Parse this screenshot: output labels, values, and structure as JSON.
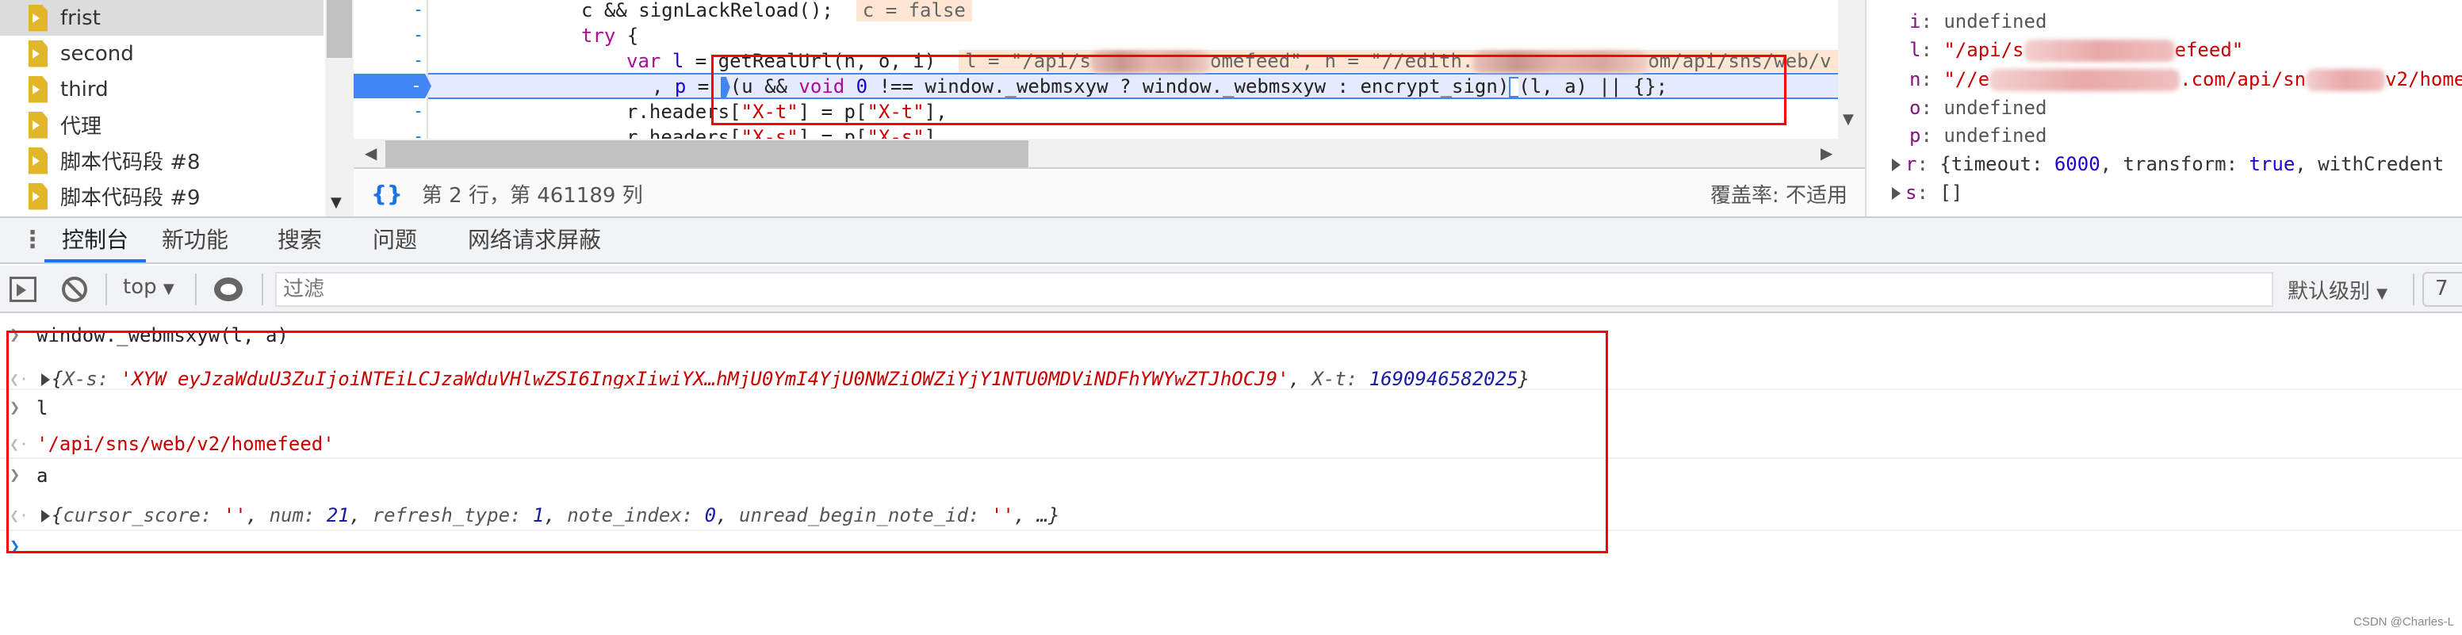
{
  "sidebar": {
    "items": [
      {
        "label": "frist",
        "selected": true,
        "icon": "snippet-file-icon"
      },
      {
        "label": "second",
        "icon": "snippet-file-icon"
      },
      {
        "label": "third",
        "icon": "snippet-file-icon"
      },
      {
        "label": "代理",
        "icon": "snippet-file-icon"
      },
      {
        "label": "脚本代码段 #8",
        "icon": "snippet-file-icon"
      },
      {
        "label": "脚本代码段 #9",
        "icon": "snippet-file-icon"
      }
    ]
  },
  "editor": {
    "gutter_marker": "-",
    "lines": {
      "l0": "c && signLackReload();",
      "l0_inline": "c = false",
      "l1_kw": "try",
      "l1_rest": " {",
      "l2_kw": "var",
      "l2_var": "l",
      "l2_rest": " = getRealUrl(n, o, i)",
      "l2_inline_a": "l = \"/api/s",
      "l2_inline_b": "omefeed\", n = \"//edith.",
      "l2_inline_c": "om/api/sns/web/v",
      "l3_a": ", ",
      "l3_var": "p",
      "l3_b": " = ",
      "l3_c": "(u && ",
      "l3_kw": "void",
      "l3_num": "0",
      "l3_d": " !== window._webmsxyw ? window._webmsxyw : encrypt_sign)",
      "l3_e": "(l, a) || {};",
      "l4_a": "r.headers[",
      "l4_s1": "\"X-t\"",
      "l4_b": "] = p[",
      "l4_s2": "\"X-t\"",
      "l4_c": "],",
      "l5_a": "r.headers[",
      "l5_s1": "\"X-s\"",
      "l5_b": "] = p[",
      "l5_s2": "\"X-s\"",
      "l5_c": "]"
    },
    "status": {
      "format_icon": "{}",
      "position": "第 2 行，第 461189 列",
      "coverage": "覆盖率: 不适用"
    }
  },
  "scope": {
    "rows": [
      {
        "key": "i",
        "value": "undefined"
      },
      {
        "key": "l",
        "value_a": "\"/api/s",
        "value_b": "efeed\""
      },
      {
        "key": "n",
        "value_a": "\"//e",
        "value_b": ".com/api/sn",
        "value_c": "v2/home"
      },
      {
        "key": "o",
        "value": "undefined"
      },
      {
        "key": "p",
        "value": "undefined"
      },
      {
        "key": "r",
        "value_a": "{timeout: ",
        "num": "6000",
        "value_b": ", transform: ",
        "bool": "true",
        "value_c": ", withCredent"
      },
      {
        "key": "s",
        "value": "[]"
      }
    ]
  },
  "drawer": {
    "tabs": [
      "控制台",
      "新功能",
      "搜索",
      "问题",
      "网络请求屏蔽"
    ],
    "active_tab": "控制台"
  },
  "console_toolbar": {
    "context": "top",
    "filter_placeholder": "过滤",
    "level": "默认级别",
    "issues_count": "7"
  },
  "console": {
    "entries": [
      {
        "input": "window._webmsxyw(l, a)"
      },
      {
        "result": {
          "k1": "X-s: ",
          "v1": "'XYW_eyJzaWduU3ZuIjoiNTEiLCJzaWduVHlwZSI6IngxIiwiYX…hMjU0YmI4YjU0NWZiOWZiYjY1NTU0MDViNDFhYWYwZTJhOCJ9'",
          "sep": ", ",
          "k2": "X-t: ",
          "v2": "1690946582025",
          "open": "{",
          "close": "}"
        }
      },
      {
        "input": "l"
      },
      {
        "result_str": "'/api/sns/web/v2/homefeed'"
      },
      {
        "input": "a"
      },
      {
        "result": {
          "open": "{",
          "k1": "cursor_score: ",
          "v1": "''",
          "k2": "num: ",
          "v2": "21",
          "k3": "refresh_type: ",
          "v3": "1",
          "k4": "note_index: ",
          "v4": "0",
          "k5": "unread_begin_note_id: ",
          "v5": "''",
          "tail": ", …}"
        }
      }
    ]
  },
  "watermark": "CSDN @Charles-L",
  "colors": {
    "accent": "#1a73e8",
    "highlight_box": "#ff0000",
    "string": "#c80000",
    "keyword": "#aa0d91",
    "number": "#1c00cf"
  }
}
